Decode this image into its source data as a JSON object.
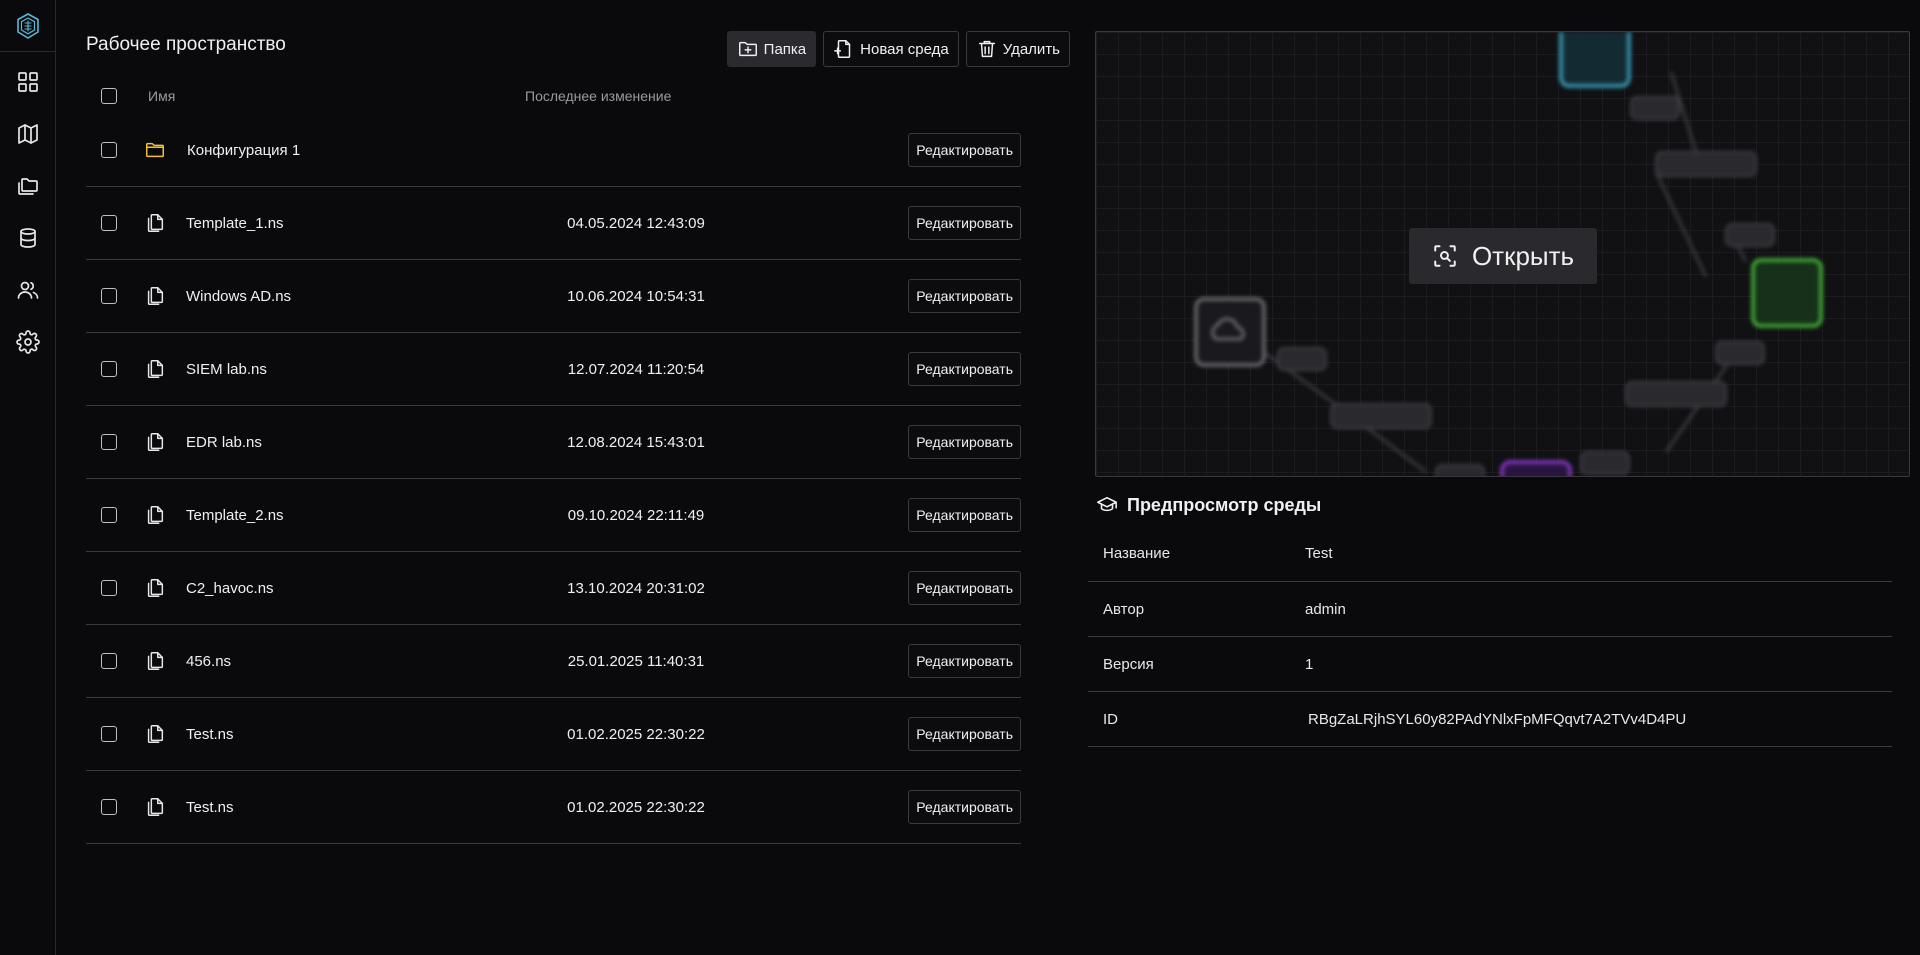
{
  "sidebar": {
    "items": [
      {
        "icon": "dashboard-icon"
      },
      {
        "icon": "map-icon"
      },
      {
        "icon": "folders-icon"
      },
      {
        "icon": "database-icon"
      },
      {
        "icon": "users-icon"
      },
      {
        "icon": "gear-icon"
      }
    ]
  },
  "workspace": {
    "title": "Рабочее пространство",
    "toolbar": {
      "folder_label": "Папка",
      "new_env_label": "Новая среда",
      "delete_label": "Удалить"
    },
    "columns": {
      "name": "Имя",
      "modified": "Последнее изменение"
    },
    "edit_label": "Редактировать",
    "rows": [
      {
        "type": "folder",
        "name": "Конфигурация 1",
        "date": ""
      },
      {
        "type": "file",
        "name": "Template_1.ns",
        "date": "04.05.2024 12:43:09"
      },
      {
        "type": "file",
        "name": "Windows AD.ns",
        "date": "10.06.2024 10:54:31"
      },
      {
        "type": "file",
        "name": "SIEM lab.ns",
        "date": "12.07.2024 11:20:54"
      },
      {
        "type": "file",
        "name": "EDR lab.ns",
        "date": "12.08.2024 15:43:01"
      },
      {
        "type": "file",
        "name": "Template_2.ns",
        "date": "09.10.2024 22:11:49"
      },
      {
        "type": "file",
        "name": "C2_havoc.ns",
        "date": "13.10.2024 20:31:02"
      },
      {
        "type": "file",
        "name": "456.ns",
        "date": "25.01.2025 11:40:31"
      },
      {
        "type": "file",
        "name": "Test.ns",
        "date": "01.02.2025 22:30:22"
      },
      {
        "type": "file",
        "name": "Test.ns",
        "date": "01.02.2025 22:30:22"
      }
    ]
  },
  "preview": {
    "open_label": "Открыть",
    "title": "Предпросмотр среды",
    "fields": [
      {
        "key": "Название",
        "value": "Test"
      },
      {
        "key": "Автор",
        "value": "admin"
      },
      {
        "key": "Версия",
        "value": "1"
      },
      {
        "key": "ID",
        "value": "RBgZaLRjhSYL60y82PAdYNlxFpMFQqvt7A2TVv4D4PU"
      }
    ],
    "colors": {
      "node_cyan": "#3fb8d6",
      "node_green": "#4ccf3c",
      "node_purple": "#9b3fe0",
      "node_gray": "#8a8a90"
    }
  },
  "colors": {
    "background": "#0a0a0c",
    "folder": "#f2c330",
    "border": "#3a3a3f"
  }
}
